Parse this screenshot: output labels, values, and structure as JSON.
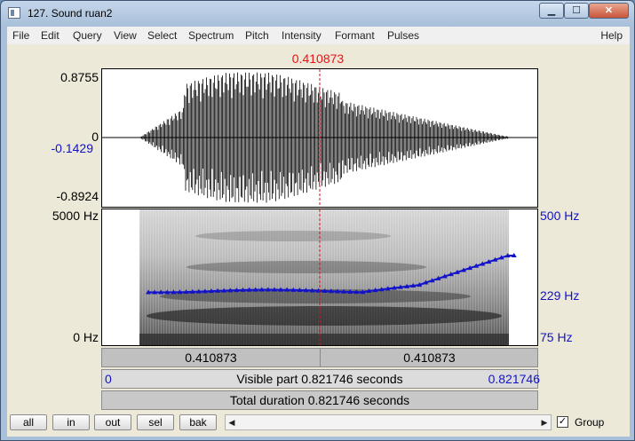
{
  "window": {
    "title": "127. Sound ruan2",
    "min_symbol": "▁",
    "max_symbol": "☐",
    "close_symbol": "✕"
  },
  "menu": [
    "File",
    "Edit",
    "Query",
    "View",
    "Select",
    "Spectrum",
    "Pitch",
    "Intensity",
    "Formant",
    "Pulses"
  ],
  "help": "Help",
  "cursor_time": "0.410873",
  "waveform": {
    "max_label": "0.8755",
    "zero_label": "0",
    "cursor_value_label": "-0.1429",
    "min_label": "-0.8924"
  },
  "spectrogram": {
    "top_label": "5000 Hz",
    "bottom_label": "0 Hz"
  },
  "pitch": {
    "top_label": "500 Hz",
    "mid_label": "229 Hz",
    "bottom_label": "75 Hz"
  },
  "time_bar": {
    "left": "0.410873",
    "right": "0.410873"
  },
  "visible_bar": {
    "start": "0",
    "text": "Visible part 0.821746 seconds",
    "end": "0.821746"
  },
  "total_bar": {
    "text": "Total duration 0.821746 seconds"
  },
  "buttons": [
    "all",
    "in",
    "out",
    "sel",
    "bak"
  ],
  "group": {
    "label": "Group",
    "checked": true,
    "check_mark": "✓"
  },
  "colors": {
    "cursor": "#dd1111",
    "pitch": "#1212c8",
    "label_blue": "#1212c8"
  }
}
